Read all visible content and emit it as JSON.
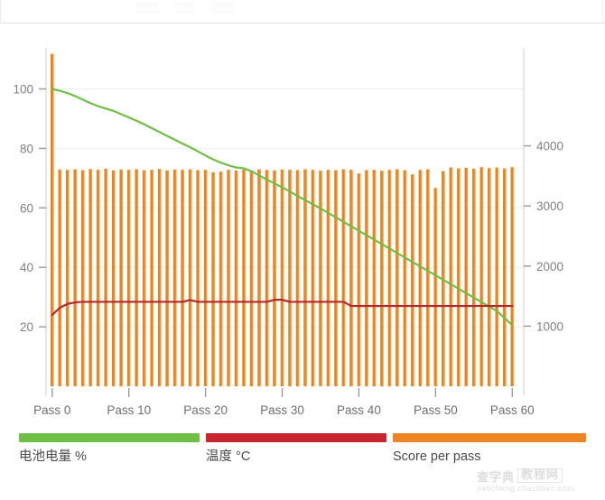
{
  "window": {
    "top_strip_present": true
  },
  "legend": {
    "items": [
      {
        "label": "电池电量 %",
        "color": "#6fbe45",
        "name": "battery-percent"
      },
      {
        "label": "温度 °C",
        "color": "#c8252f",
        "name": "temperature-celsius"
      },
      {
        "label": "Score per pass",
        "color": "#f08322",
        "name": "score-per-pass"
      }
    ]
  },
  "watermark": {
    "line1": "查字典",
    "line2": "教程网",
    "url": "jiaocheng.chazidian.com"
  },
  "chart_data": {
    "type": "bar",
    "title": "",
    "xlabel": "",
    "ylabel": "",
    "grid": true,
    "legend_position": "bottom",
    "x_tick_labels": [
      "Pass 0",
      "Pass 10",
      "Pass 20",
      "Pass 30",
      "Pass 40",
      "Pass 50",
      "Pass 60"
    ],
    "x_tick_values": [
      0,
      10,
      20,
      30,
      40,
      50,
      60
    ],
    "xlim": [
      -0.8,
      61.5
    ],
    "left_axis": {
      "label": "",
      "ticks": [
        20,
        40,
        60,
        80,
        100
      ],
      "ylim": [
        0,
        112
      ],
      "unit": "% / °C"
    },
    "right_axis": {
      "label": "",
      "ticks": [
        1000,
        2000,
        3000,
        4000
      ],
      "ylim": [
        0,
        5540
      ],
      "unit": "score"
    },
    "categories": [
      0,
      1,
      2,
      3,
      4,
      5,
      6,
      7,
      8,
      9,
      10,
      11,
      12,
      13,
      14,
      15,
      16,
      17,
      18,
      19,
      20,
      21,
      22,
      23,
      24,
      25,
      26,
      27,
      28,
      29,
      30,
      31,
      32,
      33,
      34,
      35,
      36,
      37,
      38,
      39,
      40,
      41,
      42,
      43,
      44,
      45,
      46,
      47,
      48,
      49,
      50,
      51,
      52,
      53,
      54,
      55,
      56,
      57,
      58,
      59,
      60
    ],
    "series": [
      {
        "name": "Score per pass",
        "type": "bar",
        "axis": "right",
        "color": "#e8841f",
        "values": [
          5530,
          3605,
          3600,
          3610,
          3595,
          3615,
          3600,
          3620,
          3590,
          3605,
          3600,
          3610,
          3595,
          3600,
          3615,
          3590,
          3605,
          3600,
          3610,
          3595,
          3600,
          3560,
          3570,
          3600,
          3590,
          3605,
          3595,
          3610,
          3600,
          3590,
          3605,
          3600,
          3595,
          3610,
          3600,
          3585,
          3600,
          3595,
          3610,
          3600,
          3540,
          3595,
          3600,
          3585,
          3600,
          3610,
          3595,
          3525,
          3600,
          3610,
          3300,
          3580,
          3640,
          3625,
          3635,
          3620,
          3645,
          3630,
          3640,
          3625,
          3645
        ]
      },
      {
        "name": "电池电量 %",
        "type": "line",
        "axis": "left",
        "color": "#6fbe45",
        "values": [
          100,
          99.4,
          98.6,
          97.6,
          96.4,
          95.2,
          94.2,
          93.4,
          92.6,
          91.5,
          90.4,
          89.3,
          88.1,
          86.8,
          85.5,
          84.2,
          82.9,
          81.6,
          80.4,
          79.0,
          77.6,
          76.3,
          75.2,
          74.3,
          73.6,
          73.3,
          72.3,
          70.9,
          69.5,
          68.2,
          66.9,
          65.5,
          64.0,
          62.6,
          61.2,
          59.8,
          58.3,
          56.8,
          55.3,
          53.8,
          52.3,
          50.8,
          49.3,
          47.8,
          46.3,
          44.8,
          43.3,
          41.8,
          40.3,
          38.8,
          37.3,
          35.8,
          34.3,
          32.8,
          31.3,
          29.8,
          28.3,
          26.8,
          25.3,
          23.0,
          20.5
        ]
      },
      {
        "name": "温度 °C",
        "type": "line",
        "axis": "left",
        "color": "#b4282d",
        "values": [
          24.0,
          26.4,
          27.7,
          28.2,
          28.4,
          28.4,
          28.4,
          28.4,
          28.4,
          28.4,
          28.4,
          28.4,
          28.4,
          28.4,
          28.4,
          28.4,
          28.4,
          28.4,
          29.0,
          28.4,
          28.4,
          28.4,
          28.4,
          28.4,
          28.4,
          28.4,
          28.4,
          28.4,
          28.4,
          29.1,
          29.1,
          28.4,
          28.4,
          28.4,
          28.4,
          28.4,
          28.4,
          28.4,
          28.4,
          27.0,
          27.0,
          27.0,
          27.0,
          27.0,
          27.0,
          27.0,
          27.0,
          27.0,
          27.0,
          27.0,
          27.0,
          27.0,
          27.0,
          27.0,
          27.0,
          27.0,
          27.0,
          27.0,
          27.0,
          27.0,
          27.0
        ]
      }
    ]
  }
}
